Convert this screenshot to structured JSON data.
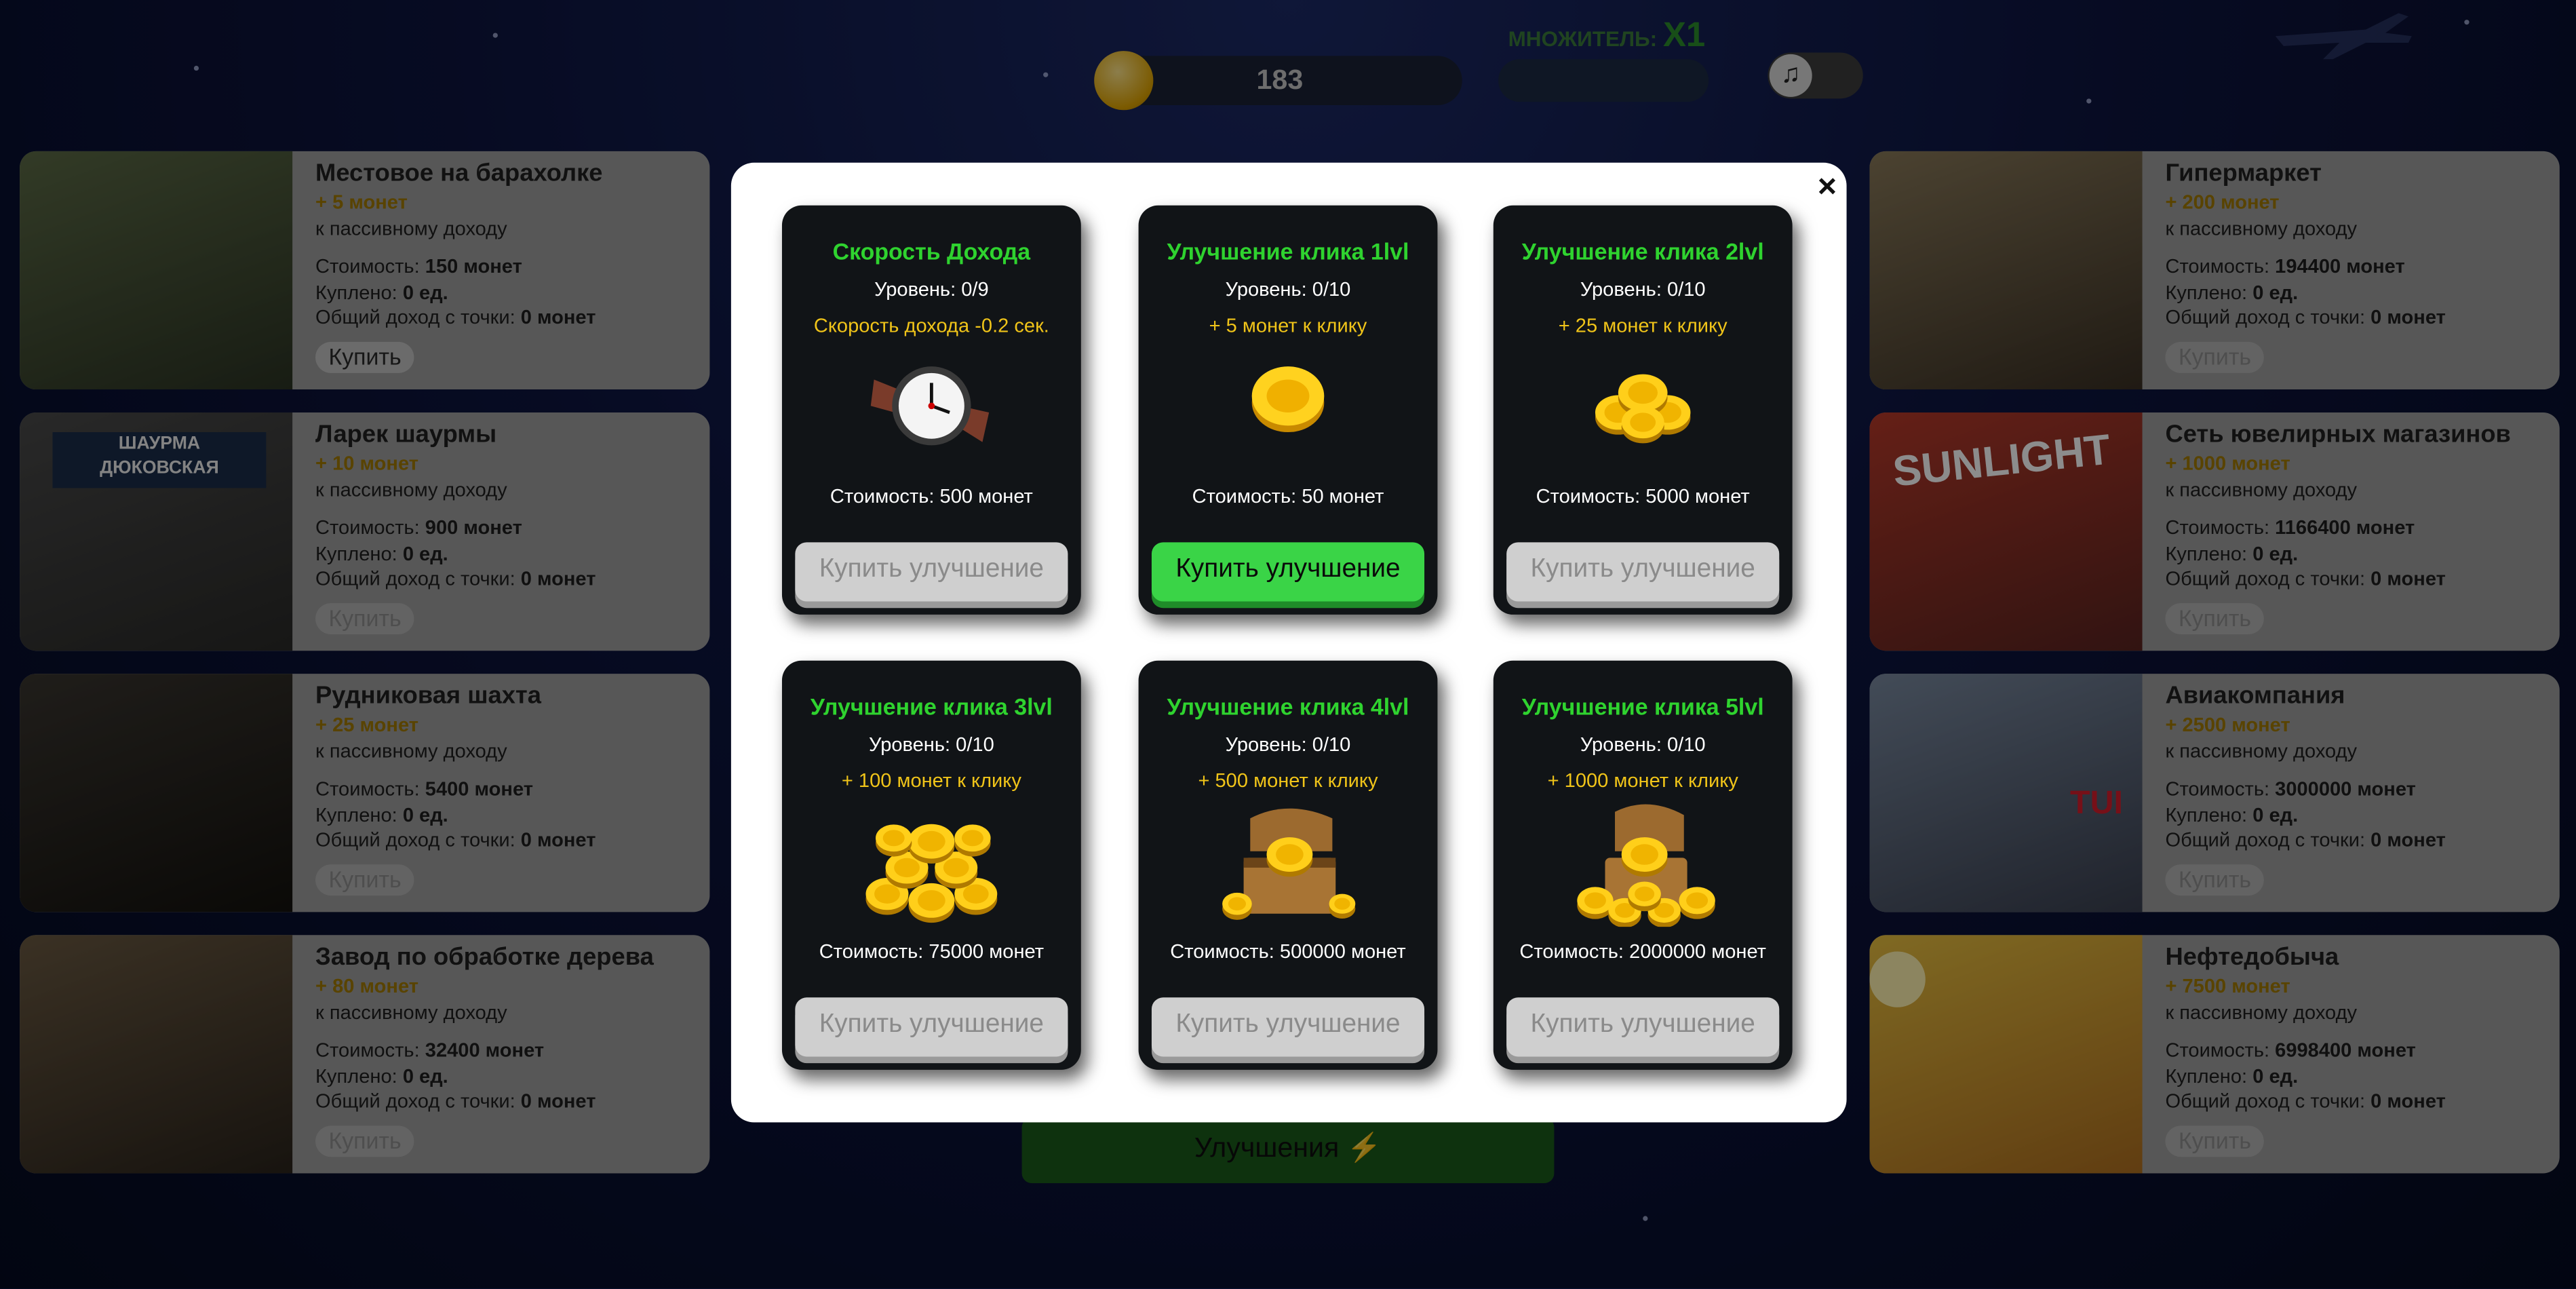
{
  "header": {
    "coins": "183",
    "multiplier_label": "МНОЖИТЕЛЬ:",
    "multiplier_value": "X1"
  },
  "left_businesses": [
    {
      "name": "Местовое на барахолке",
      "income": "+ 5 монет",
      "income_note": "к пассивному доходу",
      "cost_label": "Стоимость:",
      "cost": "150 монет",
      "bought_label": "Куплено:",
      "bought": "0 ед.",
      "total_label": "Общий доход с точки:",
      "total": "0 монет",
      "buy": "Купить",
      "buy_active": true
    },
    {
      "name": "Ларек шаурмы",
      "income": "+ 10 монет",
      "income_note": "к пассивному доходу",
      "cost_label": "Стоимость:",
      "cost": "900 монет",
      "bought_label": "Куплено:",
      "bought": "0 ед.",
      "total_label": "Общий доход с точки:",
      "total": "0 монет",
      "buy": "Купить",
      "buy_active": false
    },
    {
      "name": "Рудниковая шахта",
      "income": "+ 25 монет",
      "income_note": "к пассивному доходу",
      "cost_label": "Стоимость:",
      "cost": "5400 монет",
      "bought_label": "Куплено:",
      "bought": "0 ед.",
      "total_label": "Общий доход с точки:",
      "total": "0 монет",
      "buy": "Купить",
      "buy_active": false
    },
    {
      "name": "Завод по обработке дерева",
      "income": "+ 80 монет",
      "income_note": "к пассивному доходу",
      "cost_label": "Стоимость:",
      "cost": "32400 монет",
      "bought_label": "Куплено:",
      "bought": "0 ед.",
      "total_label": "Общий доход с точки:",
      "total": "0 монет",
      "buy": "Купить",
      "buy_active": false
    }
  ],
  "right_businesses": [
    {
      "name": "Гипермаркет",
      "income": "+ 200 монет",
      "income_note": "к пассивному доходу",
      "cost_label": "Стоимость:",
      "cost": "194400 монет",
      "bought_label": "Куплено:",
      "bought": "0 ед.",
      "total_label": "Общий доход с точки:",
      "total": "0 монет",
      "buy": "Купить",
      "buy_active": false
    },
    {
      "name": "Сеть ювелирных магазинов",
      "income": "+ 1000 монет",
      "income_note": "к пассивному доходу",
      "cost_label": "Стоимость:",
      "cost": "1166400 монет",
      "bought_label": "Куплено:",
      "bought": "0 ед.",
      "total_label": "Общий доход с точки:",
      "total": "0 монет",
      "buy": "Купить",
      "buy_active": false
    },
    {
      "name": "Авиакомпания",
      "income": "+ 2500 монет",
      "income_note": "к пассивному доходу",
      "cost_label": "Стоимость:",
      "cost": "3000000 монет",
      "bought_label": "Куплено:",
      "bought": "0 ед.",
      "total_label": "Общий доход с точки:",
      "total": "0 монет",
      "buy": "Купить",
      "buy_active": false
    },
    {
      "name": "Нефтедобыча",
      "income": "+ 7500 монет",
      "income_note": "к пассивному доходу",
      "cost_label": "Стоимость:",
      "cost": "6998400 монет",
      "bought_label": "Куплено:",
      "bought": "0 ед.",
      "total_label": "Общий доход с точки:",
      "total": "0 монет",
      "buy": "Купить",
      "buy_active": false
    }
  ],
  "photo_signs": {
    "shawarma_line1": "ШАУРМА",
    "shawarma_line2": "ДЮКОВСКАЯ",
    "sunlight": "SUNLIGHT",
    "tui": "TUI"
  },
  "upgrades_button": "Улучшения",
  "modal": {
    "close": "×",
    "cards": [
      {
        "title": "Скорость Дохода",
        "level": "Уровень: 0/9",
        "bonus": "Скорость дохода -0.2 сек.",
        "icon": "watch-icon",
        "cost": "Стоимость: 500 монет",
        "button": "Купить улучшение",
        "active": false
      },
      {
        "title": "Улучшение клика 1lvl",
        "level": "Уровень: 0/10",
        "bonus": "+ 5 монет к клику",
        "icon": "coin-icon",
        "cost": "Стоимость: 50 монет",
        "button": "Купить улучшение",
        "active": true
      },
      {
        "title": "Улучшение клика 2lvl",
        "level": "Уровень: 0/10",
        "bonus": "+ 25 монет к клику",
        "icon": "coins-small-stack-icon",
        "cost": "Стоимость: 5000 монет",
        "button": "Купить улучшение",
        "active": false
      },
      {
        "title": "Улучшение клика 3lvl",
        "level": "Уровень: 0/10",
        "bonus": "+ 100 монет к клику",
        "icon": "coins-pile-icon",
        "cost": "Стоимость: 75000 монет",
        "button": "Купить улучшение",
        "active": false
      },
      {
        "title": "Улучшение клика 4lvl",
        "level": "Уровень: 0/10",
        "bonus": "+ 500 монет к клику",
        "icon": "treasure-chest-icon",
        "cost": "Стоимость: 500000 монет",
        "button": "Купить улучшение",
        "active": false
      },
      {
        "title": "Улучшение клика 5lvl",
        "level": "Уровень: 0/10",
        "bonus": "+ 1000 монет к клику",
        "icon": "treasure-chest-large-icon",
        "cost": "Стоимость: 2000000 монет",
        "button": "Купить улучшение",
        "active": false
      }
    ]
  },
  "colors": {
    "title_green": "#2fd32f",
    "bonus_yellow": "#f0c419",
    "active_button": "#3ad447",
    "disabled_button": "#cfcfcf",
    "card_bg": "#111417"
  }
}
